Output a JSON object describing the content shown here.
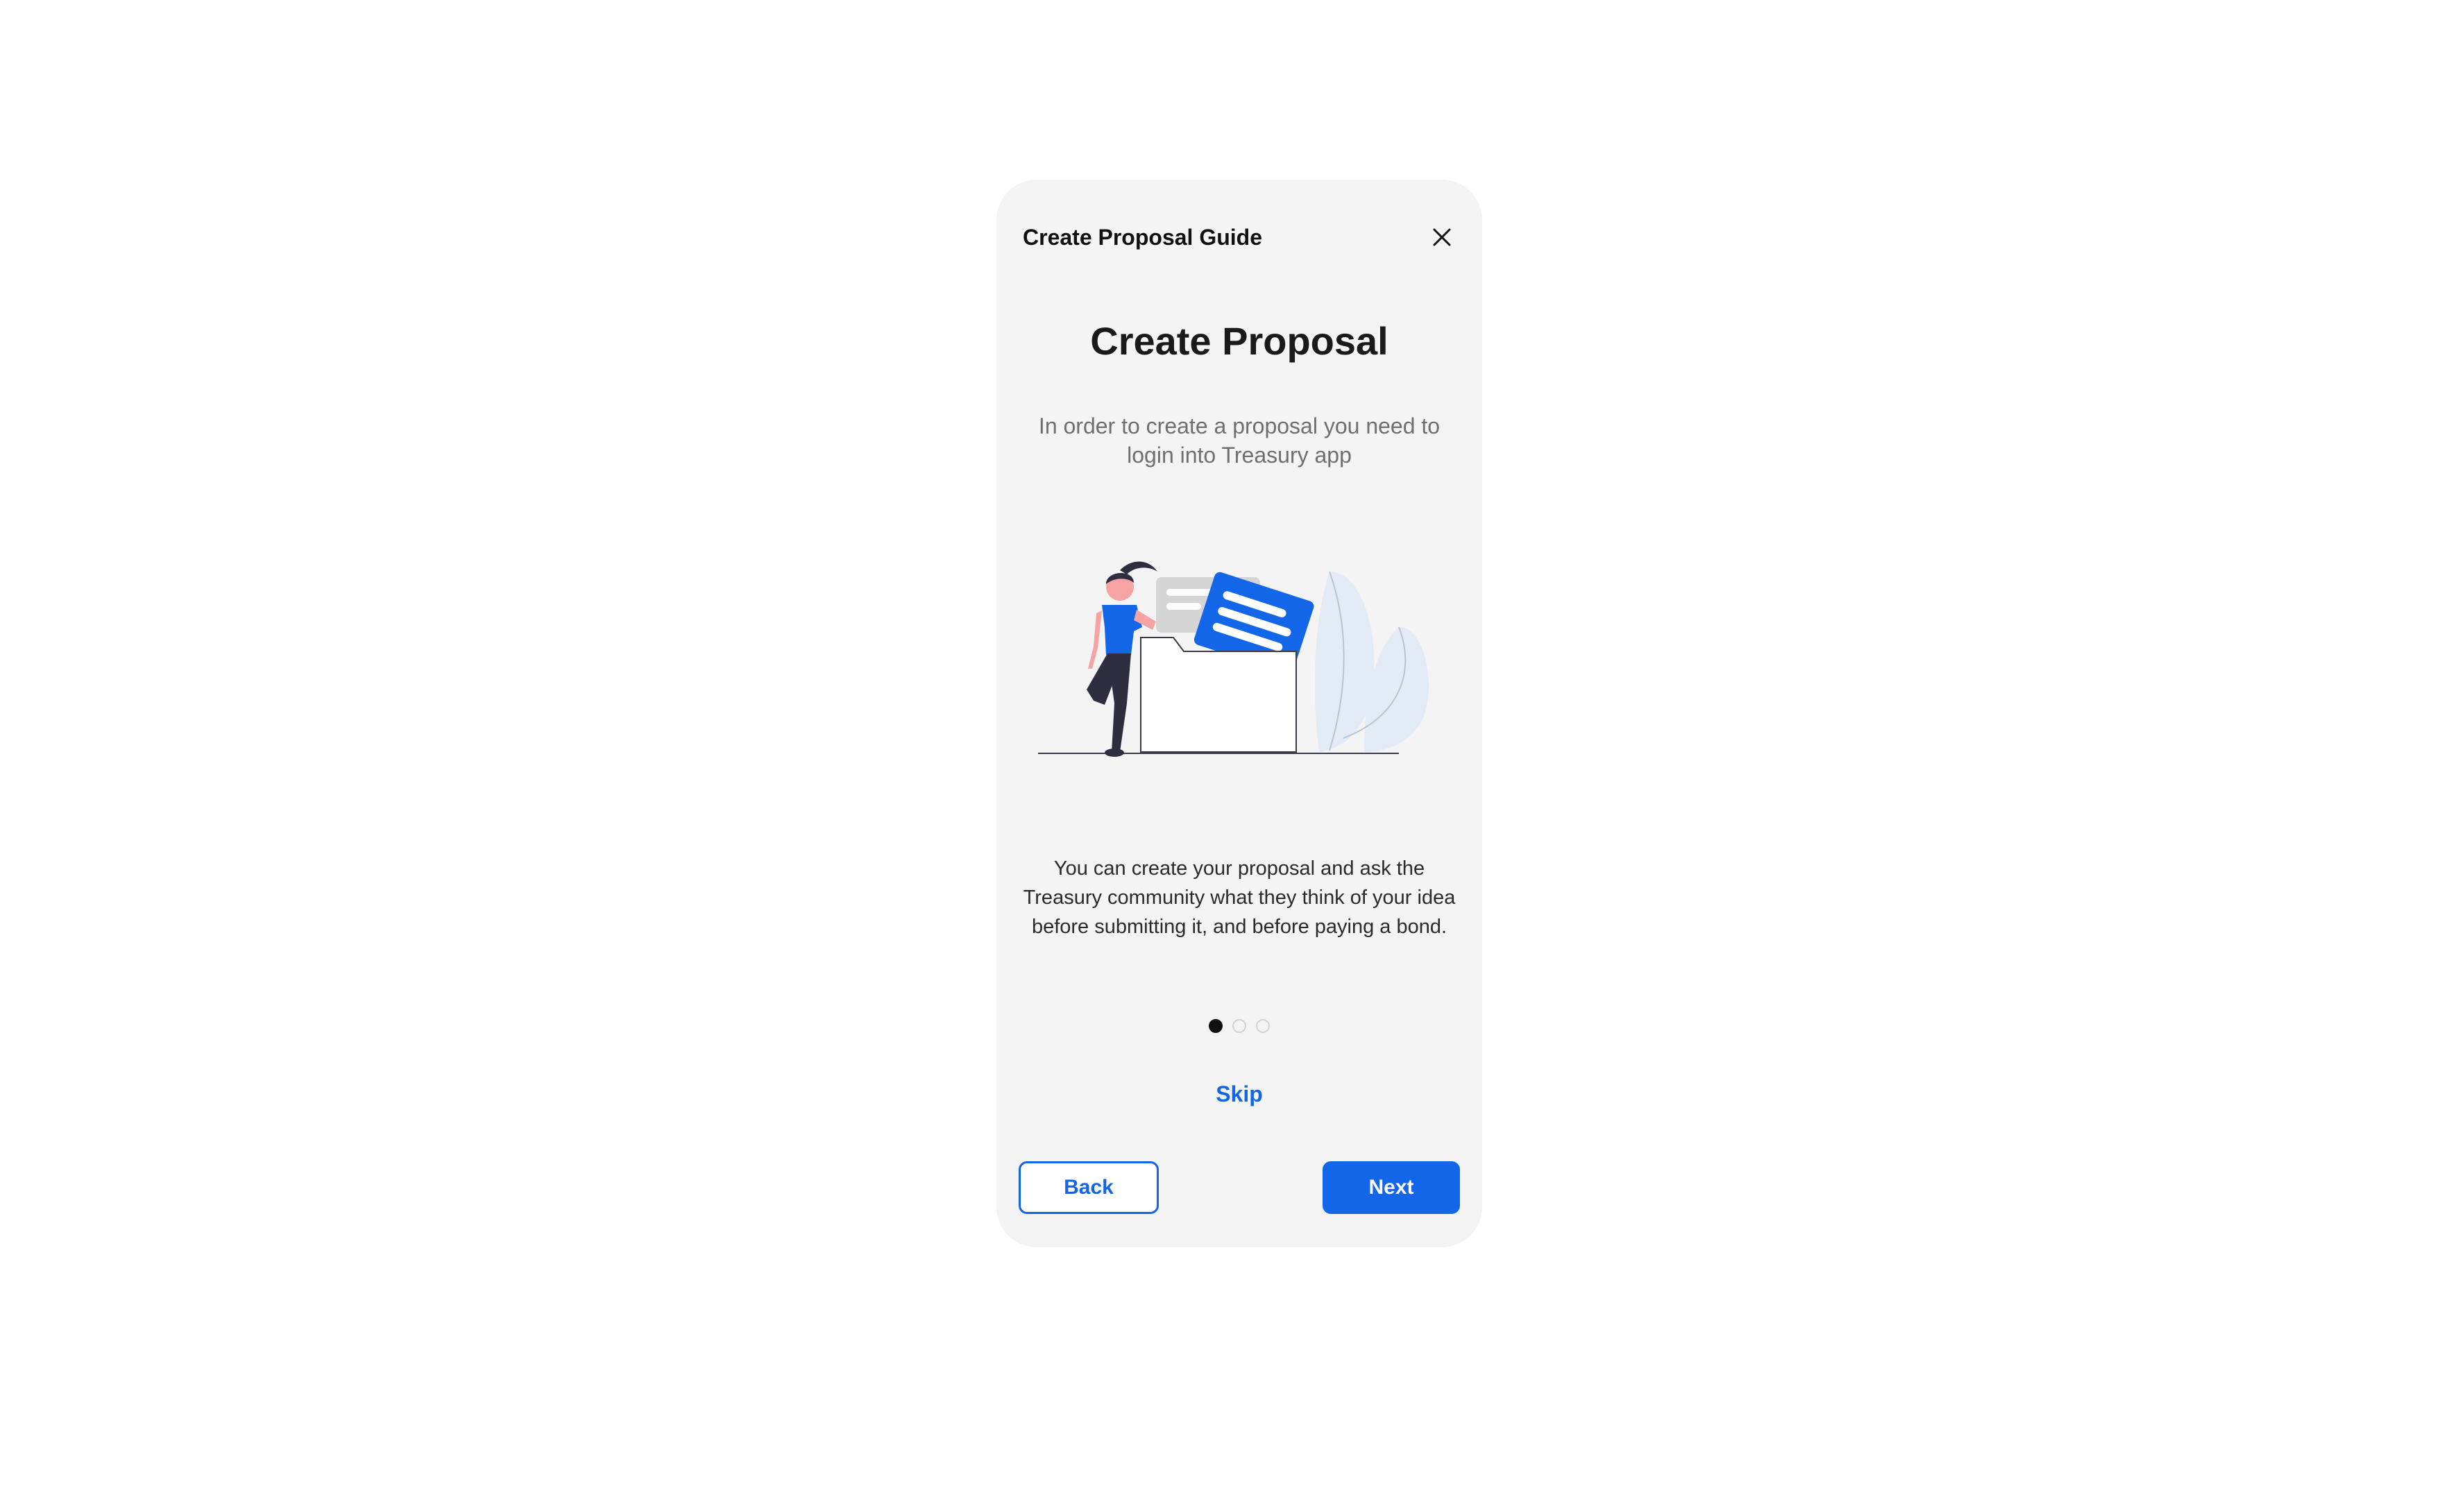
{
  "modal": {
    "title": "Create Proposal Guide",
    "close_icon": "close-icon"
  },
  "step": {
    "heading": "Create Proposal",
    "subtitle_line1": "In order to create a proposal you need to",
    "subtitle_line2": "login into Treasury app",
    "description_line1": "You can create your proposal and ask the",
    "description_line2": "Treasury community what they think of your idea",
    "description_line3": "before submitting it, and before paying a bond.",
    "illustration": "woman-with-document-folder-illustration"
  },
  "pagination": {
    "total": 3,
    "current": 1
  },
  "actions": {
    "skip_label": "Skip",
    "back_label": "Back",
    "next_label": "Next"
  },
  "colors": {
    "accent": "#1366e8",
    "modal_bg": "#f4f4f4",
    "text_primary": "#1a1a1a",
    "text_secondary": "#6f6f6f"
  }
}
